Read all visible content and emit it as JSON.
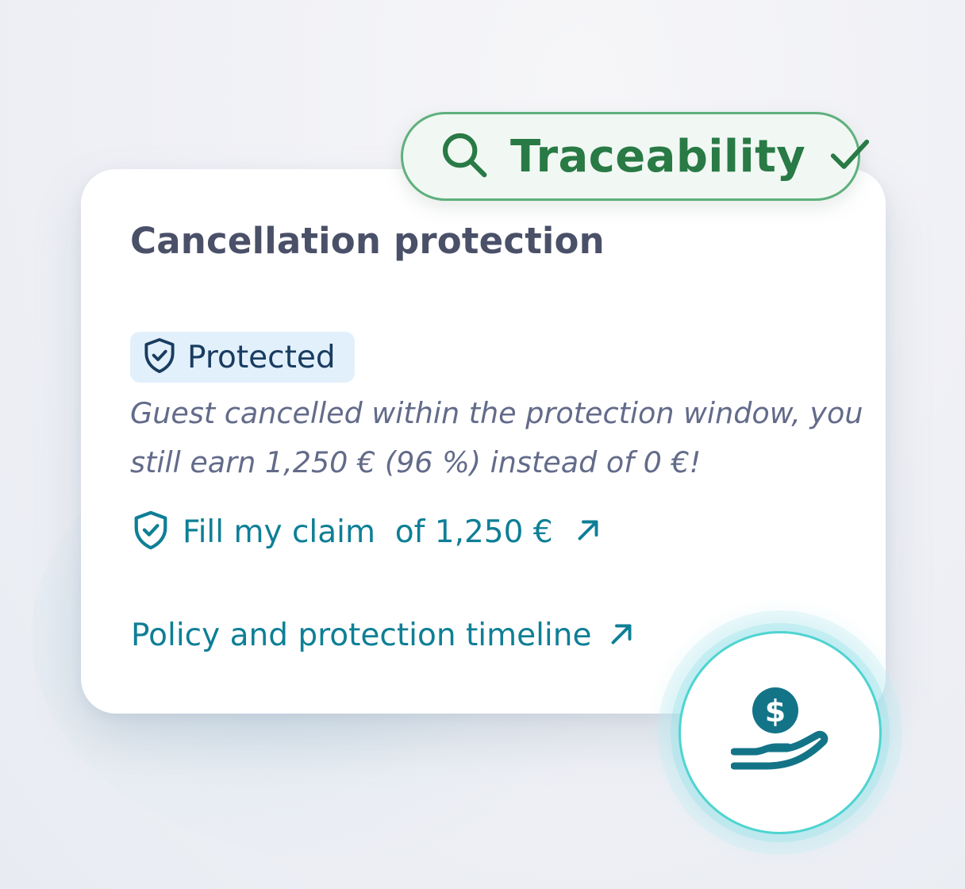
{
  "trace_badge": {
    "label": "Traceability",
    "icon_search": "search-icon",
    "icon_check": "check-icon",
    "color": "#297a45",
    "border_color": "#5fb07d"
  },
  "card": {
    "title": "Cancellation protection",
    "status": {
      "label": "Protected",
      "icon": "shield-check-icon",
      "color": "#193c60",
      "background": "#e2f0fc"
    },
    "message": "Guest cancelled within the protection window, you still earn 1,250 € (96 %) instead of 0 €!",
    "claim_link": {
      "label": "Fill my claim  of 1,250 €",
      "icon": "shield-check-icon",
      "arrow_icon": "arrow-up-right-icon"
    },
    "policy_link": {
      "label": "Policy and protection timeline",
      "arrow_icon": "arrow-up-right-icon"
    },
    "link_color": "#0e7f96"
  },
  "floating_icon": {
    "icon": "hand-holding-dollar-icon",
    "accent": "#4ed4d0"
  }
}
